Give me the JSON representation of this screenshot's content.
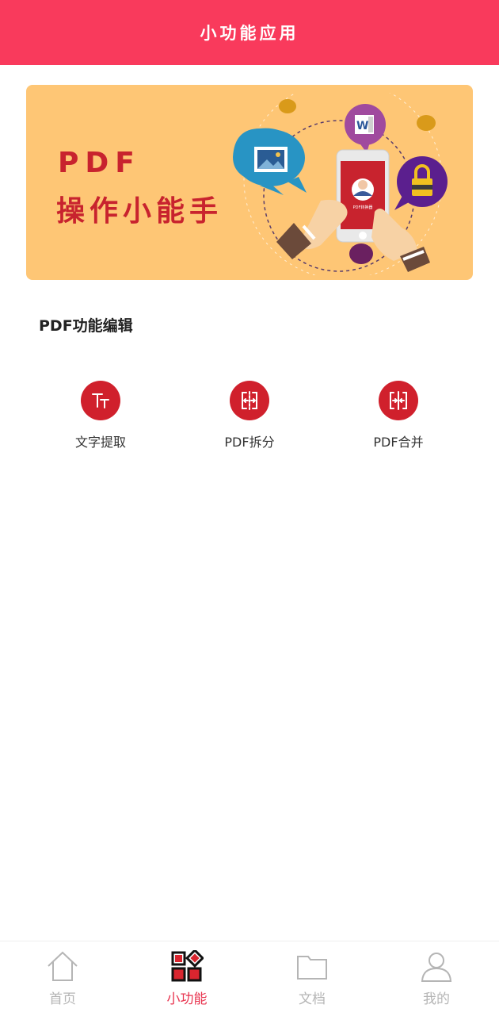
{
  "header": {
    "title": "小功能应用"
  },
  "banner": {
    "line1": "PDF",
    "line2": "操作小能手",
    "phone_caption": "PDF转换器"
  },
  "section": {
    "title": "PDF功能编辑"
  },
  "tools": [
    {
      "label": "文字提取",
      "icon": "text-size-icon"
    },
    {
      "label": "PDF拆分",
      "icon": "split-icon"
    },
    {
      "label": "PDF合并",
      "icon": "merge-icon"
    }
  ],
  "tabbar": {
    "items": [
      {
        "label": "首页",
        "icon": "home-icon",
        "active": false
      },
      {
        "label": "小功能",
        "icon": "apps-icon",
        "active": true
      },
      {
        "label": "文档",
        "icon": "folder-icon",
        "active": false
      },
      {
        "label": "我的",
        "icon": "user-icon",
        "active": false
      }
    ]
  },
  "colors": {
    "primary": "#f93a5c",
    "tool_icon_bg": "#d0202c",
    "banner_bg": "#fec675",
    "tab_inactive": "#b5b5b5"
  }
}
